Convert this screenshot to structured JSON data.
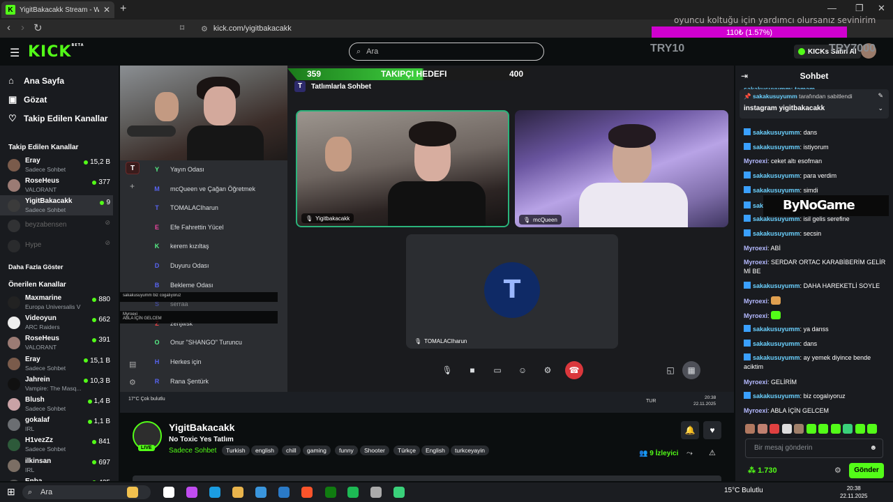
{
  "browser": {
    "tab_title": "YigitBakacakk Stream - Watch L",
    "url": "kick.com/yigitbakacakk"
  },
  "overlay": {
    "scroll_text": "oyuncu koltuğu için yardımcı olursanız sevinirim",
    "price": "110₺ (1.57%)",
    "currency_left": "TRY10",
    "currency_right": "TRY7000"
  },
  "header": {
    "logo": "KICK",
    "logo_sup": "BETA",
    "search_placeholder": "Ara",
    "kicks_label": "KICKs Satın Al"
  },
  "sidebar": {
    "nav": [
      {
        "label": "Ana Sayfa",
        "icon": "home-icon",
        "glyph": "⌂"
      },
      {
        "label": "Gözat",
        "icon": "browse-icon",
        "glyph": "▣"
      },
      {
        "label": "Takip Edilen Kanallar",
        "icon": "heart-icon",
        "glyph": "♡"
      }
    ],
    "followed_title": "Takip Edilen Kanallar",
    "followed": [
      {
        "name": "Eray",
        "sub": "Sadece Sohbet",
        "viewers": "15,2 B",
        "color": "#7a5b4b"
      },
      {
        "name": "RoseHeus",
        "sub": "VALORANT",
        "viewers": "377",
        "color": "#9b7b74"
      },
      {
        "name": "YigitBakacakk",
        "sub": "Sadece Sohbet",
        "viewers": "9",
        "color": "#3b3b3b"
      },
      {
        "name": "beyzabensen",
        "sub": "",
        "viewers": "",
        "color": "#555"
      },
      {
        "name": "Hype",
        "sub": "",
        "viewers": "",
        "color": "#444"
      }
    ],
    "show_more": "Daha Fazla Göster",
    "recommended_title": "Önerilen Kanallar",
    "recommended": [
      {
        "name": "Maxmarine",
        "sub": "Europa Universalis V",
        "viewers": "880",
        "color": "#222"
      },
      {
        "name": "Videoyun",
        "sub": "ARC Raiders",
        "viewers": "662",
        "color": "#eee"
      },
      {
        "name": "RoseHeus",
        "sub": "VALORANT",
        "viewers": "391",
        "color": "#9b7b74"
      },
      {
        "name": "Eray",
        "sub": "Sadece Sohbet",
        "viewers": "15,1 B",
        "color": "#7a5b4b"
      },
      {
        "name": "Jahrein",
        "sub": "Vampire: The Masq...",
        "viewers": "10,3 B",
        "color": "#111"
      },
      {
        "name": "Blush",
        "sub": "Sadece Sohbet",
        "viewers": "1,4 B",
        "color": "#c9a2a6"
      },
      {
        "name": "gokalaf",
        "sub": "IRL",
        "viewers": "1,1 B",
        "color": "#6b6e72"
      },
      {
        "name": "H1vezZz",
        "sub": "Sadece Sohbet",
        "viewers": "841",
        "color": "#2d5a3a"
      },
      {
        "name": "ilkinsan",
        "sub": "IRL",
        "viewers": "697",
        "color": "#7b6e64"
      },
      {
        "name": "Enba",
        "sub": "",
        "viewers": "425",
        "color": "#555"
      }
    ]
  },
  "video": {
    "goal_current": "359",
    "goal_label": "TAKIPÇI HEDEFI",
    "goal_target": "400",
    "discord_header": "Tatlımlarla Sohbet",
    "channels": [
      {
        "icon": "Y",
        "color": "#57f287",
        "label": "Yayın Odası"
      },
      {
        "icon": "M",
        "color": "#5865f2",
        "label": "mcQueen ve Çağan Öğretmek"
      },
      {
        "icon": "T",
        "color": "#5865f2",
        "label": "TOMALACIharun"
      },
      {
        "icon": "E",
        "color": "#eb459e",
        "label": "Efe Fahrettin Yücel"
      },
      {
        "icon": "K",
        "color": "#57f287",
        "label": "kerem kızıltaş"
      },
      {
        "icon": "D",
        "color": "#5865f2",
        "label": "Duyuru Odası"
      },
      {
        "icon": "B",
        "color": "#5865f2",
        "label": "Bekleme Odası"
      },
      {
        "icon": "S",
        "color": "#5865f2",
        "label": "serraa"
      },
      {
        "icon": "Z",
        "color": "#ed4245",
        "label": "zenjwsk"
      },
      {
        "icon": "O",
        "color": "#57f287",
        "label": "Onur \"SHANGO\" Turuncu"
      },
      {
        "icon": "H",
        "color": "#5865f2",
        "label": "Herkes için"
      },
      {
        "icon": "R",
        "color": "#5865f2",
        "label": "Rana Şentürk"
      }
    ],
    "tile1_label": "Yigitbakacakk",
    "tile2_label": "mcQueen",
    "tile3_label": "TOMALACIharun",
    "tile3_avatar": "T",
    "overlay1_user": "sakakusuyumm",
    "overlay1_msg": "biz cogalıyoruz",
    "overlay2_user": "Myroexi",
    "overlay2_msg": "ABLA İÇİN GELCEM",
    "inner_weather": "17°C Çok bulutlu",
    "inner_lang": "TUR",
    "inner_time": "20:38",
    "inner_date": "22.11.2025"
  },
  "stream": {
    "name": "YigitBakacakk",
    "live": "LIVE",
    "title": "No Toxic Yes Tatlım",
    "category": "Sadece Sohbet",
    "tags": [
      "Turkish",
      "english",
      "chill",
      "gaming",
      "funny",
      "Shooter",
      "Türkçe",
      "English",
      "turkceyayin"
    ],
    "viewers": "9 İzleyici"
  },
  "chat": {
    "title": "Sohbet",
    "top_partial": "sakakusuyumm: tamam",
    "pinned_user": "sakakusuyumm",
    "pinned_by": "tarafından sabitlendi",
    "pinned_msg": "instagram yigitbakacakk",
    "messages": [
      {
        "user": "sakakusuyumm",
        "text": "dans",
        "badge": true,
        "color": "#6bd1ff"
      },
      {
        "user": "sakakusuyumm",
        "text": "istiyorum",
        "badge": true,
        "color": "#6bd1ff"
      },
      {
        "user": "Myroexi",
        "text": "ceket altı esofman",
        "badge": false,
        "color": "#b4b9ff"
      },
      {
        "user": "sakakusuyumm",
        "text": "para verdim",
        "badge": true,
        "color": "#6bd1ff"
      },
      {
        "user": "sakakusuyumm",
        "text": "simdi",
        "badge": true,
        "color": "#6bd1ff"
      },
      {
        "user": "sakakusuyumm",
        "text": "",
        "badge": true,
        "color": "#6bd1ff"
      },
      {
        "user": "sakakusuyumm",
        "text": "isil gelis serefine",
        "badge": true,
        "color": "#6bd1ff"
      },
      {
        "user": "sakakusuyumm",
        "text": "secsin",
        "badge": true,
        "color": "#6bd1ff"
      },
      {
        "user": "Myroexi",
        "text": "ABİ",
        "badge": false,
        "color": "#b4b9ff"
      },
      {
        "user": "Myroexi",
        "text": "SERDAR ORTAC KARABİBERİM GELİR Mİ BE",
        "badge": false,
        "color": "#b4b9ff"
      },
      {
        "user": "sakakusuyumm",
        "text": "DAHA HAREKETLİ SOYLE",
        "badge": true,
        "color": "#6bd1ff"
      },
      {
        "user": "Myroexi",
        "text": "",
        "badge": false,
        "color": "#b4b9ff"
      },
      {
        "user": "Myroexi",
        "text": "",
        "badge": false,
        "color": "#b4b9ff"
      },
      {
        "user": "sakakusuyumm",
        "text": "ya danss",
        "badge": true,
        "color": "#6bd1ff"
      },
      {
        "user": "sakakusuyumm",
        "text": "dans",
        "badge": true,
        "color": "#6bd1ff"
      },
      {
        "user": "sakakusuyumm",
        "text": "ay yemek diyince bende aciktim",
        "badge": true,
        "color": "#6bd1ff"
      },
      {
        "user": "Myroexi",
        "text": "GELİRİM",
        "badge": false,
        "color": "#b4b9ff"
      },
      {
        "user": "sakakusuyumm",
        "text": "biz cogalıyoruz",
        "badge": true,
        "color": "#6bd1ff"
      },
      {
        "user": "Myroexi",
        "text": "ABLA İÇİN GELCEM",
        "badge": false,
        "color": "#b4b9ff"
      }
    ],
    "sponsor": "ByNoGame",
    "input_placeholder": "Bir mesaj gönderin",
    "points": "1.730",
    "send_label": "Gönder"
  },
  "taskbar": {
    "search": "Ara",
    "weather": "15°C Bulutlu",
    "time": "20:38",
    "date": "22.11.2025"
  }
}
